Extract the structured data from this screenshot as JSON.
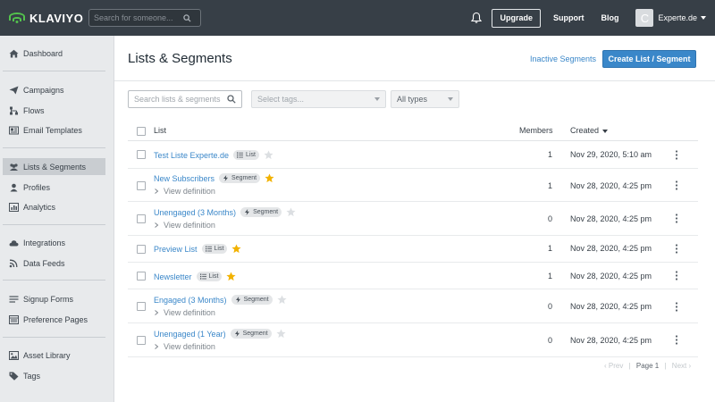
{
  "topbar": {
    "logo_text": "KLAVIYO",
    "search_placeholder": "Search for someone...",
    "upgrade_label": "Upgrade",
    "support_label": "Support",
    "blog_label": "Blog",
    "avatar_initial": "C",
    "account_name": "Experte.de"
  },
  "sidebar": {
    "items": [
      {
        "label": "Dashboard",
        "icon": "home-icon"
      },
      {
        "label": "Campaigns",
        "icon": "paper-plane-icon"
      },
      {
        "label": "Flows",
        "icon": "flows-icon"
      },
      {
        "label": "Email Templates",
        "icon": "email-template-icon"
      },
      {
        "label": "Lists & Segments",
        "icon": "users-icon",
        "active": true
      },
      {
        "label": "Profiles",
        "icon": "user-icon"
      },
      {
        "label": "Analytics",
        "icon": "analytics-icon"
      },
      {
        "label": "Integrations",
        "icon": "cloud-icon"
      },
      {
        "label": "Data Feeds",
        "icon": "rss-icon"
      },
      {
        "label": "Signup Forms",
        "icon": "form-icon"
      },
      {
        "label": "Preference Pages",
        "icon": "preference-page-icon"
      },
      {
        "label": "Asset Library",
        "icon": "image-icon"
      },
      {
        "label": "Tags",
        "icon": "tag-icon"
      }
    ]
  },
  "header": {
    "title": "Lists & Segments",
    "inactive_segments_label": "Inactive Segments",
    "create_label": "Create List / Segment"
  },
  "filters": {
    "search_placeholder": "Search lists & segments",
    "tags_placeholder": "Select tags...",
    "type_value": "All types"
  },
  "table": {
    "columns": {
      "list": "List",
      "members": "Members",
      "created": "Created"
    },
    "view_definition_label": "View definition",
    "rows": [
      {
        "name": "Test Liste Experte.de",
        "type": "List",
        "starred": false,
        "members": "1",
        "created": "Nov 29, 2020, 5:10 am"
      },
      {
        "name": "New Subscribers",
        "type": "Segment",
        "starred": true,
        "members": "1",
        "created": "Nov 28, 2020, 4:25 pm"
      },
      {
        "name": "Unengaged (3 Months)",
        "type": "Segment",
        "starred": false,
        "members": "0",
        "created": "Nov 28, 2020, 4:25 pm"
      },
      {
        "name": "Preview List",
        "type": "List",
        "starred": true,
        "members": "1",
        "created": "Nov 28, 2020, 4:25 pm"
      },
      {
        "name": "Newsletter",
        "type": "List",
        "starred": true,
        "members": "1",
        "created": "Nov 28, 2020, 4:25 pm"
      },
      {
        "name": "Engaged (3 Months)",
        "type": "Segment",
        "starred": false,
        "members": "0",
        "created": "Nov 28, 2020, 4:25 pm"
      },
      {
        "name": "Unengaged (1 Year)",
        "type": "Segment",
        "starred": false,
        "members": "0",
        "created": "Nov 28, 2020, 4:25 pm"
      }
    ]
  },
  "pagination": {
    "prev": "‹ Prev",
    "sep": "|",
    "page": "Page 1",
    "next": "Next ›"
  },
  "colors": {
    "topbar": "#373f47",
    "accent": "#3a87c9",
    "logo_green": "#53c24d",
    "star_active": "#f2b200",
    "star_inactive": "#dcdfe2"
  }
}
